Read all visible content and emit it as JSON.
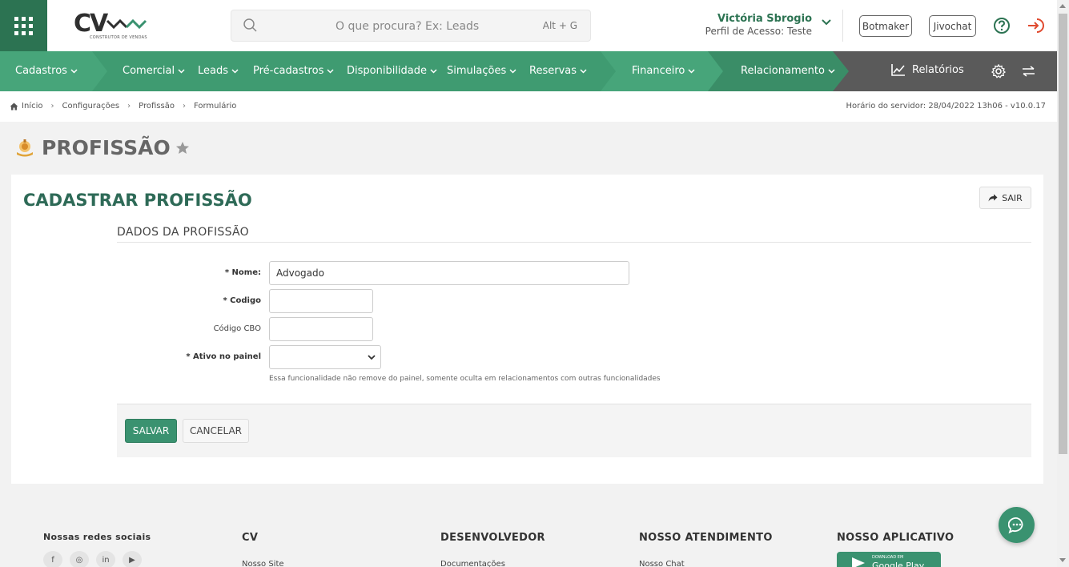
{
  "header": {
    "logo_text": "CV",
    "logo_subtitle": "CONSTRUTOR DE VENDAS",
    "search_placeholder": "O que procura? Ex: Leads",
    "search_shortcut": "Alt + G",
    "user_name": "Victória Sbrogio",
    "user_profile": "Perfil de Acesso: Teste",
    "botmaker_label": "Botmaker",
    "jivochat_label": "Jivochat"
  },
  "nav": {
    "items": [
      "Cadastros",
      "Comercial",
      "Leads",
      "Pré-cadastros",
      "Disponibilidade",
      "Simulações",
      "Reservas",
      "Financeiro",
      "Relacionamento"
    ],
    "reports_label": "Relatórios"
  },
  "breadcrumb": [
    "Início",
    "Configurações",
    "Profissão",
    "Formulário"
  ],
  "server_time": "Horário do servidor: 28/04/2022 13h06 - v10.0.17",
  "page": {
    "title": "PROFISSÃO",
    "card_title": "CADASTRAR PROFISSÃO",
    "exit_label": "SAIR",
    "section_title": "DADOS DA PROFISSÃO"
  },
  "form": {
    "name_label": "* Nome:",
    "name_value": "Advogado",
    "code_label": "* Codigo",
    "code_value": "",
    "cbo_label": "Código CBO",
    "cbo_value": "",
    "active_label": "* Ativo no painel",
    "active_value": "",
    "helper_text": "Essa funcionalidade não remove do painel, somente oculta em relacionamentos com outras funcionalidades",
    "save_label": "SALVAR",
    "cancel_label": "CANCELAR"
  },
  "footer": {
    "social_title": "Nossas redes sociais",
    "social_icons": [
      "f",
      "◎",
      "in",
      "▶"
    ],
    "col_cv": "CV",
    "col_cv_link": "Nosso Site",
    "col_dev": "DESENVOLVEDOR",
    "col_dev_link": "Documentações",
    "col_support": "NOSSO ATENDIMENTO",
    "col_support_link": "Nosso Chat",
    "col_app": "NOSSO APLICATIVO",
    "gplay_small": "DOWNLOAD EM",
    "gplay_big": "Google Play"
  },
  "colors": {
    "brand_green": "#2c7352",
    "nav_green": "#3f9b71",
    "nav_dark": "#5a5a5a",
    "title_green": "#2e6a57",
    "button_green": "#3a9270",
    "logout_red": "#e04a2f"
  }
}
